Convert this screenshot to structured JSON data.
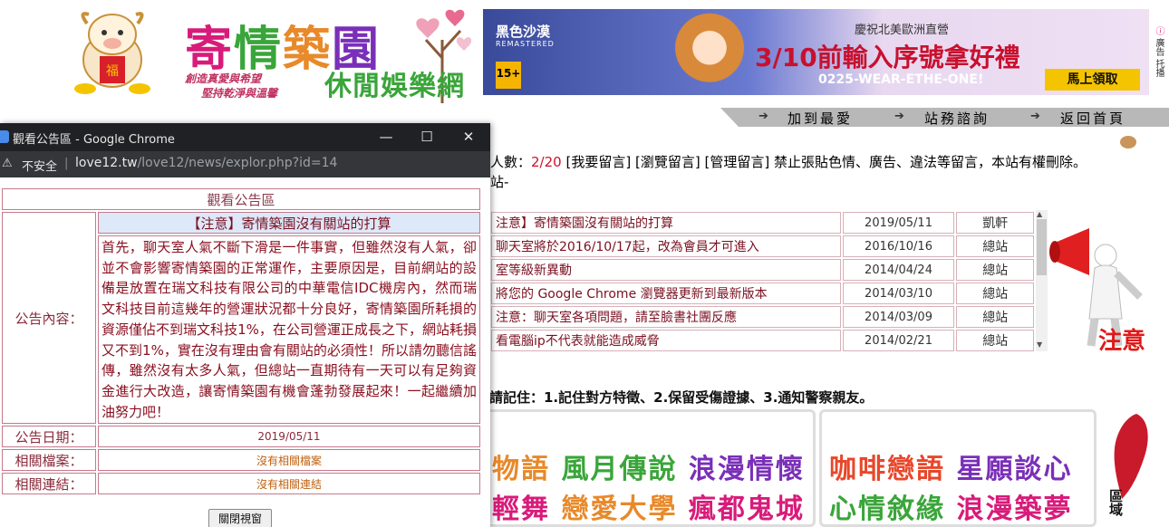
{
  "site": {
    "logo_title": [
      "寄",
      "情",
      "築",
      "園"
    ],
    "logo_title_colors": [
      "#d81b7a",
      "#3aa53a",
      "#e8892a",
      "#7a2fb8"
    ],
    "logo_subtitle": "休閒娛樂網",
    "slogan_1": "創造真愛與希望",
    "slogan_2": "堅持乾淨與溫馨",
    "ad": {
      "game": "黑色沙漠",
      "game_sub": "REMASTERED",
      "rating": "15+",
      "line1": "慶祝北美歐洲直營",
      "line2": "3/10前輸入序號拿好禮",
      "line3": "0225-WEAR-ETHE-ONE!",
      "button": "馬上領取",
      "side_text": "廣告 托播"
    },
    "nav": [
      "加到最愛",
      "站務諮詢",
      "返回首頁"
    ],
    "stats": {
      "prefix": "人數：",
      "count": "2/20",
      "links": [
        "[我要留言]",
        "[瀏覽留言]",
        "[管理留言]"
      ],
      "notice": "禁止張貼色情、廣告、違法等留言，本站有權刪除。",
      "line2": "站-"
    },
    "news": [
      {
        "title": "注意】寄情築園沒有關站的打算",
        "date": "2019/05/11",
        "author": "凱軒"
      },
      {
        "title": "聊天室將於2016/10/17起，改為會員才可進入",
        "date": "2016/10/16",
        "author": "總站"
      },
      {
        "title": "室等級新異動",
        "date": "2014/04/24",
        "author": "總站"
      },
      {
        "title": "將您的 Google Chrome 瀏覽器更新到最新版本",
        "date": "2014/03/10",
        "author": "總站"
      },
      {
        "title": "注意：聊天室各項問題，請至臉書社團反應",
        "date": "2014/03/09",
        "author": "總站"
      },
      {
        "title": "看電腦ip不代表就能造成威脅",
        "date": "2014/02/21",
        "author": "總站"
      }
    ],
    "attention": "注意",
    "warning_line": "請記住：1.記住對方特徵、2.保留受傷證據、3.通知警察親友。",
    "panel1": {
      "row1": [
        "物語",
        "風月傳說",
        "浪漫情懷"
      ],
      "row2": [
        "輕舞",
        "戀愛大學",
        "瘋都鬼城"
      ],
      "colors": [
        "#e8892a",
        "#3aa53a",
        "#7a2fb8",
        "#d81b7a"
      ]
    },
    "panel2": {
      "row1": [
        "咖啡戀語",
        "星願談心"
      ],
      "row2": [
        "心情敘緣",
        "浪漫築夢"
      ],
      "colors": [
        "#e8472a",
        "#7a2fb8",
        "#3aa53a",
        "#d81b7a"
      ]
    },
    "region": "區域"
  },
  "popup": {
    "window_title": "觀看公告區 - Google Chrome",
    "insecure": "不安全",
    "url_host": "love12.tw",
    "url_path": "/love12/news/explor.php?id=14",
    "header": "觀看公告區",
    "label_content": "公告內容：",
    "subject": "【注意】寄情築園沒有關站的打算",
    "body": "首先，聊天室人氣不斷下滑是一件事實，但雖然沒有人氣，卻並不會影響寄情築園的正常運作，主要原因是，目前網站的設備是放置在瑞文科技有限公司的中華電信IDC機房內，然而瑞文科技目前這幾年的營運狀況都十分良好，寄情築園所耗損的資源僅佔不到瑞文科技1%，在公司營運正成長之下，網站耗損又不到1%，實在沒有理由會有關站的必須性！所以請勿聽信謠傳，雖然沒有太多人氣，但總站一直期待有一天可以有足夠資金進行大改造，讓寄情築園有機會蓬勃發展起來！一起繼續加油努力吧！",
    "label_date": "公告日期：",
    "date": "2019/05/11",
    "label_file": "相關檔案：",
    "file": "沒有相關檔案",
    "label_link": "相關連結：",
    "link": "沒有相關連結",
    "close_button": "關閉視窗"
  }
}
